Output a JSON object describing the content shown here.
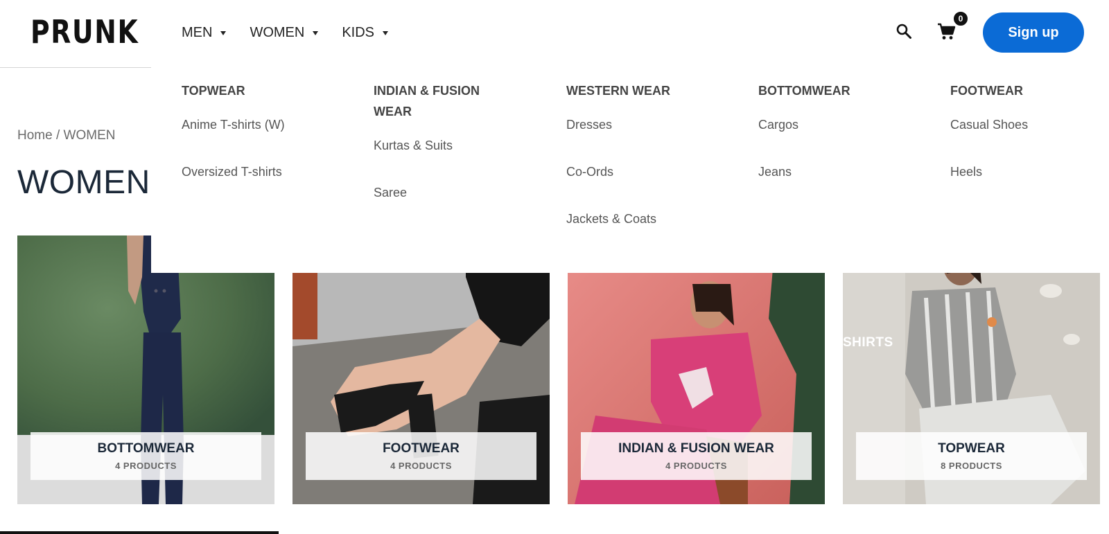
{
  "brand": {
    "logo_text": "PRUNK"
  },
  "nav": {
    "items": [
      {
        "label": "MEN"
      },
      {
        "label": "WOMEN"
      },
      {
        "label": "KIDS"
      }
    ]
  },
  "header": {
    "cart_count": "0",
    "signup_label": "Sign up",
    "icons": [
      "search-icon",
      "cart-icon",
      "caret-down-icon"
    ]
  },
  "breadcrumb": {
    "home": "Home",
    "separator": " / ",
    "current": "WOMEN"
  },
  "page_title": "WOMEN",
  "mega_menu": {
    "columns": [
      {
        "heading": "TOPWEAR",
        "links": [
          "Anime T-shirts (W)",
          "Oversized T-shirts"
        ]
      },
      {
        "heading": "INDIAN & FUSION WEAR",
        "links": [
          "Kurtas & Suits",
          "Saree"
        ]
      },
      {
        "heading": "WESTERN WEAR",
        "links": [
          "Dresses",
          "Co-Ords",
          "Jackets & Coats"
        ]
      },
      {
        "heading": "BOTTOMWEAR",
        "links": [
          "Cargos",
          "Jeans"
        ]
      },
      {
        "heading": "FOOTWEAR",
        "links": [
          "Casual Shoes",
          "Heels"
        ]
      }
    ]
  },
  "categories": [
    {
      "title": "BOTTOMWEAR",
      "count": "4 PRODUCTS"
    },
    {
      "title": "FOOTWEAR",
      "count": "4 PRODUCTS"
    },
    {
      "title": "INDIAN & FUSION WEAR",
      "count": "4 PRODUCTS"
    },
    {
      "title": "TOPWEAR",
      "count": "8 PRODUCTS",
      "overlay_text": "SHIRTS"
    }
  ],
  "colors": {
    "accent": "#0b6bd6",
    "title": "#1b2838"
  }
}
